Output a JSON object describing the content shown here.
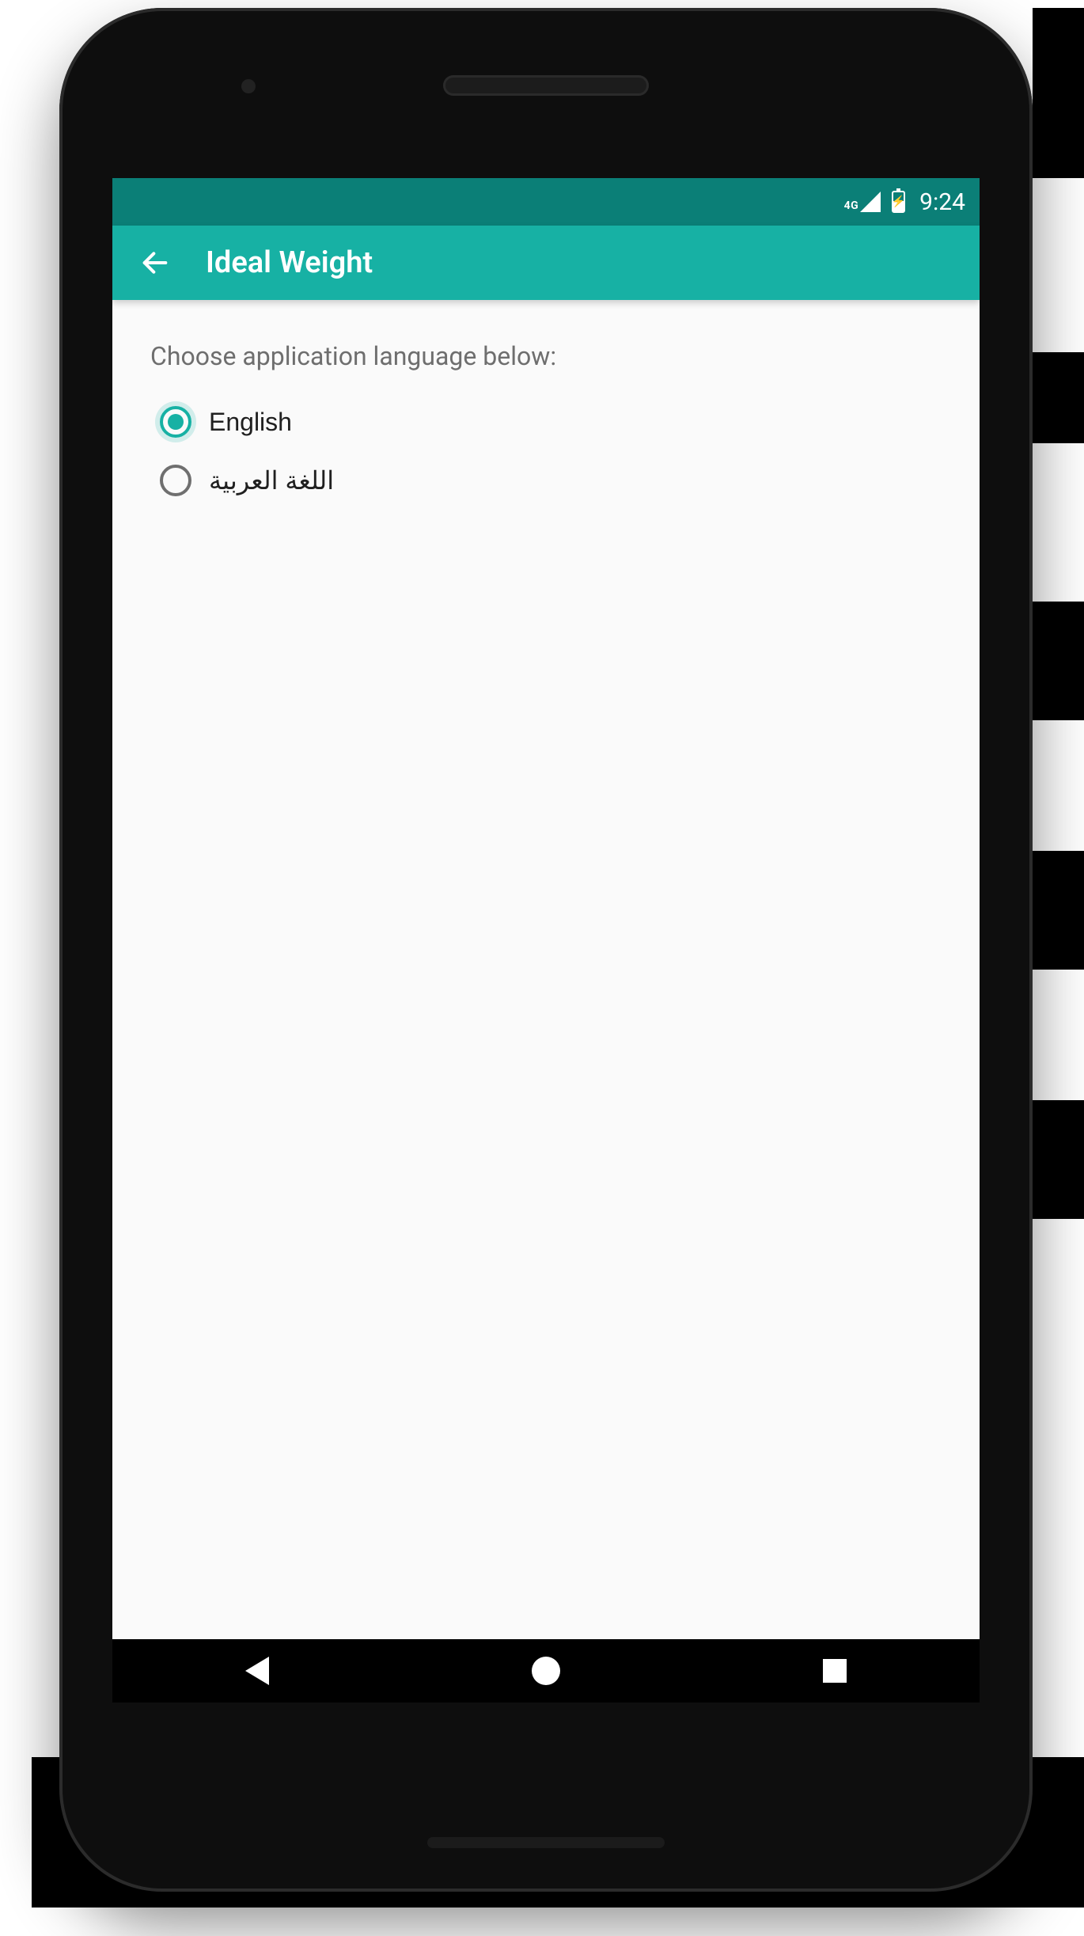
{
  "statusbar": {
    "network_label": "4G",
    "time": "9:24"
  },
  "appbar": {
    "title": "Ideal Weight"
  },
  "content": {
    "prompt": "Choose application language below:",
    "languages": [
      {
        "label": "English",
        "selected": true
      },
      {
        "label": "اللغة العربية",
        "selected": false
      }
    ]
  }
}
